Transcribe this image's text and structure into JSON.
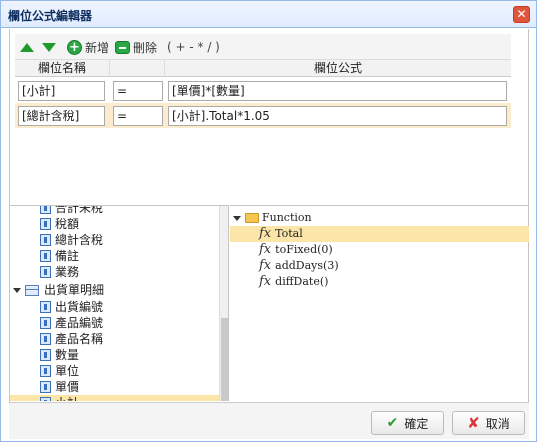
{
  "dialog": {
    "title": "欄位公式編輯器",
    "close_glyph": "✕"
  },
  "toolbar": {
    "add_label": "新增",
    "delete_label": "刪除",
    "operators": "( + - * / )"
  },
  "grid": {
    "columns": [
      "欄位名稱",
      "",
      "欄位公式"
    ],
    "rows": [
      {
        "name": "[小計]",
        "op": "=",
        "formula": "[單價]*[數量]"
      },
      {
        "name": "[總計含稅]",
        "op": "=",
        "formula": "[小計].Total*1.05"
      }
    ]
  },
  "fields_tree": {
    "items": [
      {
        "label": "合計未稅",
        "type": "field"
      },
      {
        "label": "稅額",
        "type": "field"
      },
      {
        "label": "總計含稅",
        "type": "field"
      },
      {
        "label": "備註",
        "type": "field"
      },
      {
        "label": "業務",
        "type": "field"
      },
      {
        "label": "出貨單明細",
        "type": "table"
      },
      {
        "label": "出貨編號",
        "type": "field"
      },
      {
        "label": "產品編號",
        "type": "field"
      },
      {
        "label": "產品名稱",
        "type": "field"
      },
      {
        "label": "數量",
        "type": "field"
      },
      {
        "label": "單位",
        "type": "field"
      },
      {
        "label": "單價",
        "type": "field"
      },
      {
        "label": "小計",
        "type": "field",
        "selected": true
      }
    ]
  },
  "function_tree": {
    "root": "Function",
    "items": [
      {
        "label": "Total",
        "selected": true
      },
      {
        "label": "toFixed(0)"
      },
      {
        "label": "addDays(3)"
      },
      {
        "label": "diffDate()"
      }
    ],
    "fx_glyph": "fx"
  },
  "footer": {
    "ok_label": "確定",
    "cancel_label": "取消"
  },
  "colors": {
    "accent": "#95b8e7",
    "selection": "#fbe5a8",
    "green": "#28a745"
  }
}
